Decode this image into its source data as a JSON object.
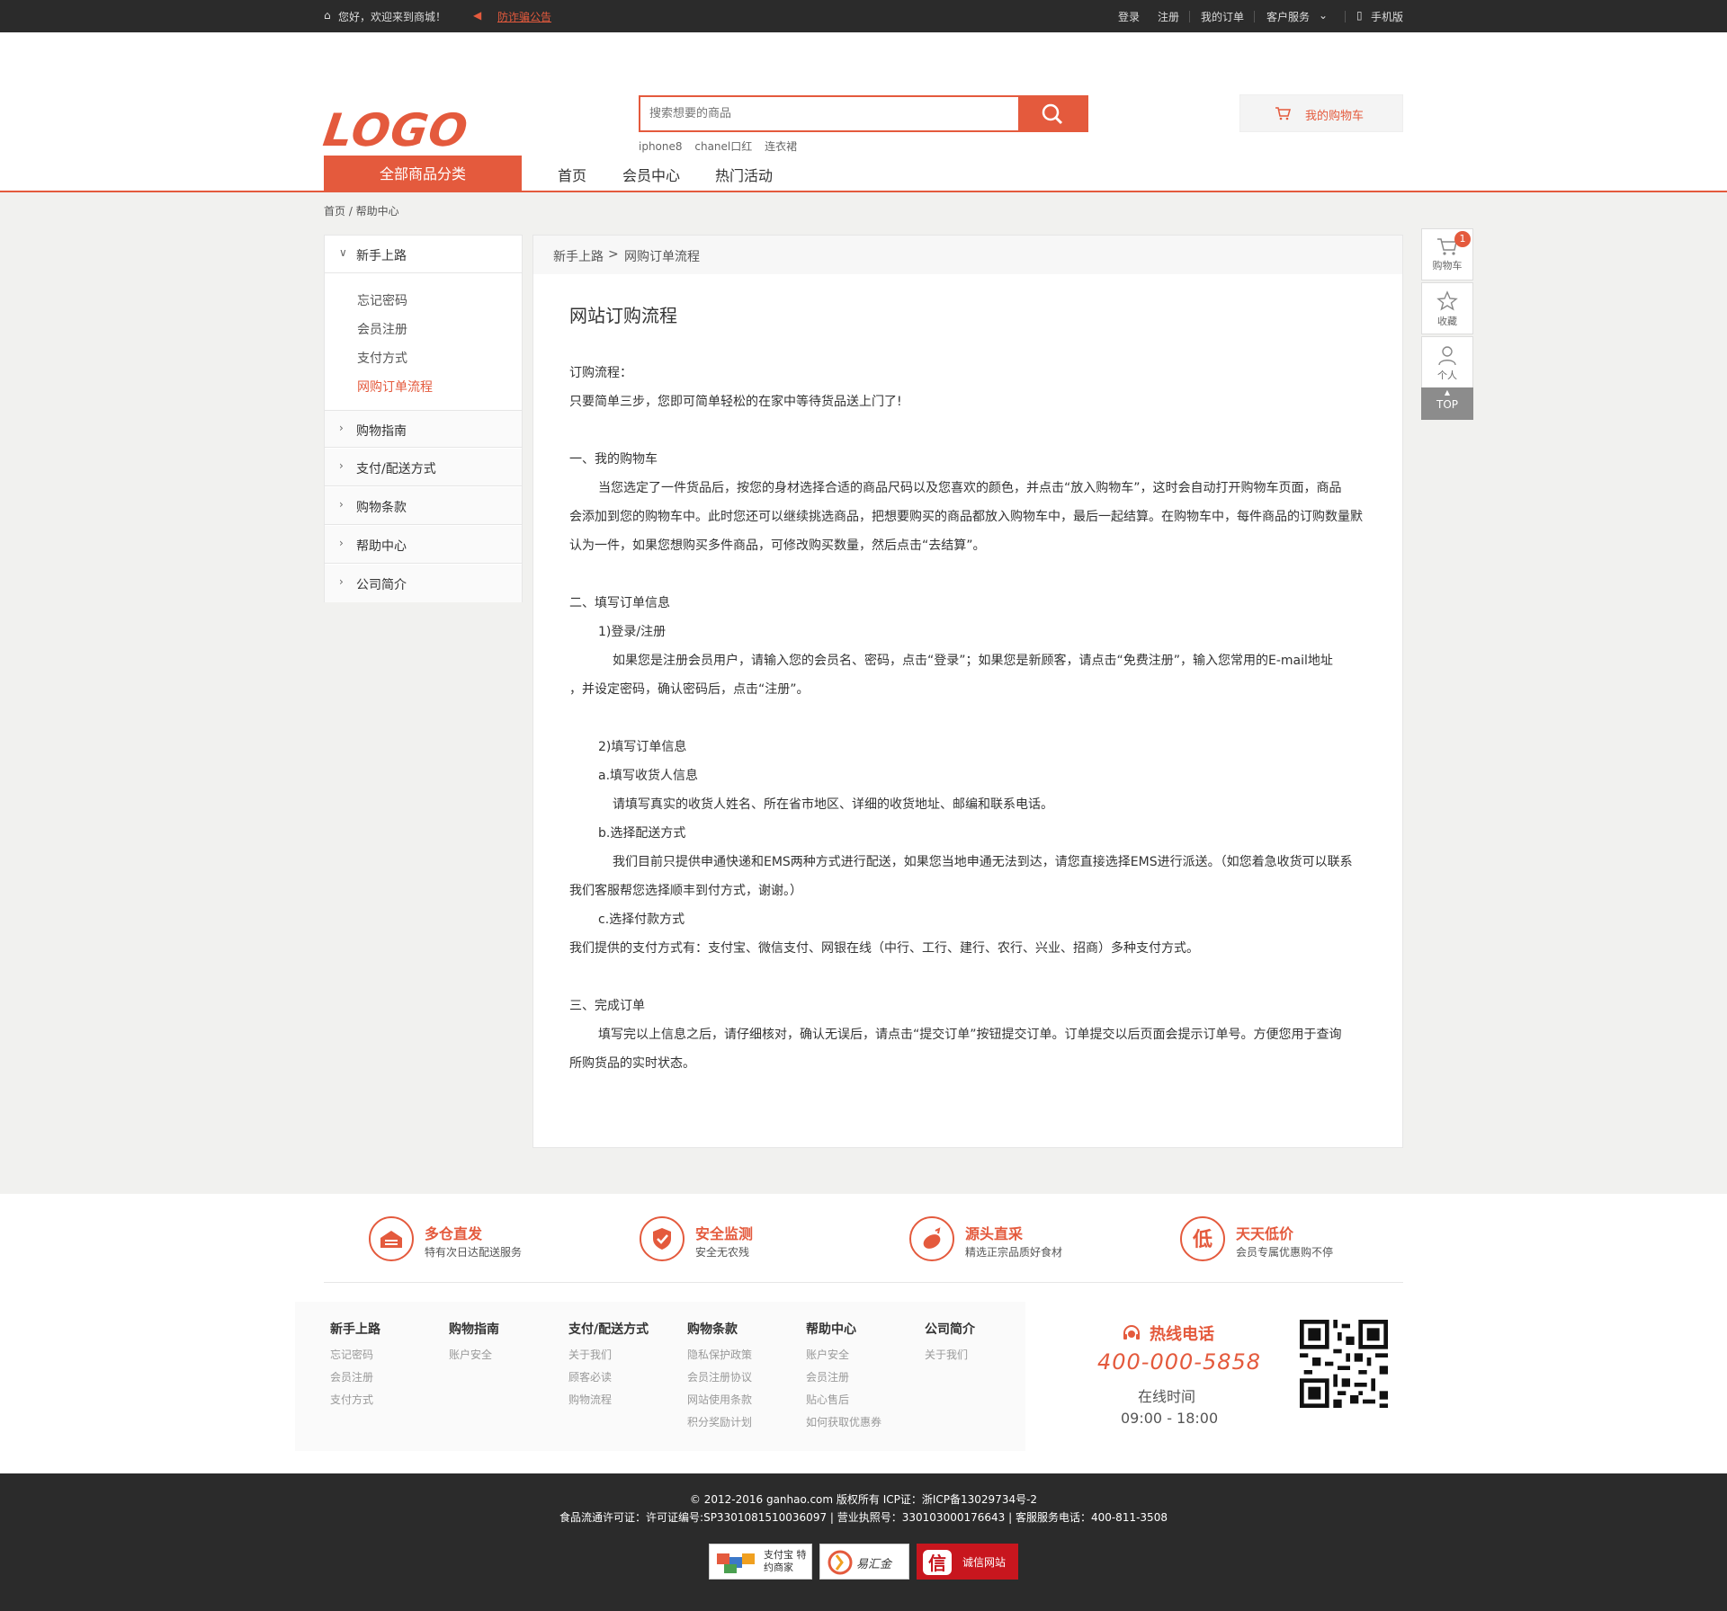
{
  "topbar": {
    "welcome": "您好，欢迎来到商城！",
    "notice": "防诈骗公告",
    "links": [
      "登录",
      "注册",
      "我的订单",
      "客户服务",
      "手机版"
    ]
  },
  "header": {
    "logo": "LOGO",
    "search_placeholder": "搜索想要的商品",
    "hotwords": [
      "iphone8",
      "chanel口红",
      "连衣裙"
    ],
    "cart_label": "我的购物车"
  },
  "nav": {
    "all_categories": "全部商品分类",
    "links": [
      "首页",
      "会员中心",
      "热门活动"
    ]
  },
  "breadcrumb": "首页 / 帮助中心",
  "sidebar": {
    "open_section": "新手上路",
    "sub_items": [
      "忘记密码",
      "会员注册",
      "支付方式",
      "网购订单流程"
    ],
    "sections": [
      "购物指南",
      "支付/配送方式",
      "购物条款",
      "帮助中心",
      "公司简介"
    ]
  },
  "content": {
    "crumb_parent": "新手上路",
    "crumb_sep": ">",
    "crumb_current": "网购订单流程",
    "title": "网站订购流程",
    "lines": [
      "订购流程：",
      "只要简单三步，您即可简单轻松的在家中等待货品送上门了!",
      "一、我的购物车",
      "当您选定了一件货品后，按您的身材选择合适的商品尺码以及您喜欢的颜色，并点击“放入购物车”，这时会自动打开购物车页面，商品",
      "会添加到您的购物车中。此时您还可以继续挑选商品，把想要购买的商品都放入购物车中，最后一起结算。在购物车中，每件商品的订购数量默",
      "认为一件，如果您想购买多件商品，可修改购买数量，然后点击“去结算”。",
      "二、填写订单信息",
      "1)登录/注册",
      "如果您是注册会员用户，请输入您的会员名、密码，点击“登录”；如果您是新顾客，请点击“免费注册”，输入您常用的E-mail地址",
      "，并设定密码，确认密码后，点击“注册”。",
      "2)填写订单信息",
      "a.填写收货人信息",
      "请填写真实的收货人姓名、所在省市地区、详细的收货地址、邮编和联系电话。",
      "b.选择配送方式",
      "我们目前只提供申通快递和EMS两种方式进行配送，如果您当地申通无法到达，请您直接选择EMS进行派送。（如您着急收货可以联系",
      "我们客服帮您选择顺丰到付方式，谢谢。）",
      "c.选择付款方式",
      "我们提供的支付方式有：支付宝、微信支付、网银在线（中行、工行、建行、农行、兴业、招商）多种支付方式。",
      "三、完成订单",
      "填写完以上信息之后，请仔细核对，确认无误后，请点击“提交订单”按钮提交订单。订单提交以后页面会提示订单号。方便您用于查询",
      "所购货品的实时状态。"
    ]
  },
  "right_toolbar": {
    "cart_label": "购物车",
    "cart_count": "1",
    "favorite_label": "收藏",
    "personal_label": "个人",
    "top_label": "TOP"
  },
  "features": [
    {
      "title": "多仓直发",
      "desc": "特有次日达配送服务",
      "icon": "warehouse-icon"
    },
    {
      "title": "安全监测",
      "desc": "安全无农残",
      "icon": "shield-check-icon"
    },
    {
      "title": "源头直采",
      "desc": "精选正宗品质好食材",
      "icon": "produce-icon"
    },
    {
      "title": "天天低价",
      "desc": "会员专属优惠购不停",
      "icon": "low-price-icon"
    }
  ],
  "footer_cols": [
    {
      "title": "新手上路",
      "items": [
        "忘记密码",
        "会员注册",
        "支付方式"
      ]
    },
    {
      "title": "购物指南",
      "items": [
        "账户安全"
      ]
    },
    {
      "title": "支付/配送方式",
      "items": [
        "关于我们",
        "顾客必读",
        "购物流程"
      ]
    },
    {
      "title": "购物条款",
      "items": [
        "隐私保护政策",
        "会员注册协议",
        "网站使用条款",
        "积分奖励计划"
      ]
    },
    {
      "title": "帮助中心",
      "items": [
        "账户安全",
        "会员注册",
        "贴心售后",
        "如何获取优惠券"
      ]
    },
    {
      "title": "公司简介",
      "items": [
        "关于我们"
      ]
    }
  ],
  "hotline": {
    "title": "热线电话",
    "number": "400-000-5858",
    "online_label": "在线时间",
    "hours": "09:00 - 18:00"
  },
  "bottom": {
    "line1": "© 2012-2016 ganhao.com 版权所有 ICP证：浙ICP备13029734号-2",
    "line2": "食品流通许可证：许可证编号:SP3301081510036097 | 营业执照号：330103000176643 | 客服服务电话：400-811-3508",
    "badges": [
      "支付宝 特约商家",
      "易汇金",
      "诚信网站"
    ]
  },
  "colors": {
    "accent": "#e45a3d",
    "dark": "#2b2b2b",
    "bg": "#f1f1ef"
  }
}
